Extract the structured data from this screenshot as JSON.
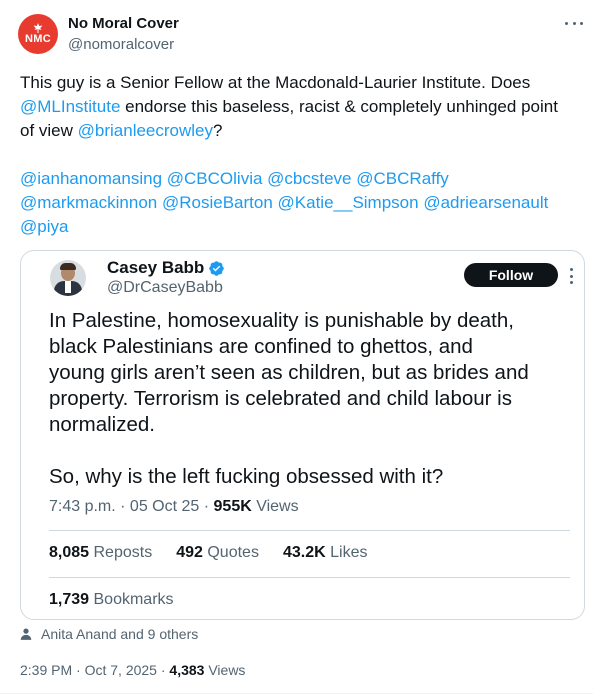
{
  "post": {
    "author": {
      "name": "No Moral Cover",
      "handle": "@nomoralcover",
      "avatar_text": "NMC",
      "avatar_color": "#e63b2e"
    },
    "text": {
      "line1": "This guy is a Senior Fellow at the Macdonald-Laurier Institute. Does",
      "mention_mli": "@MLInstitute",
      "line2_rest": " endorse this baseless, racist & completely unhinged point",
      "line3_pre": "of view ",
      "mention_crowley": "@brianleecrowley",
      "line3_post": "?",
      "mentions_line1": [
        "@ianhanomansing",
        "@CBCOlivia",
        "@cbcsteve",
        "@CBCRaffy"
      ],
      "mentions_line2": [
        "@markmackinnon",
        "@RosieBarton",
        "@Katie__Simpson",
        "@adriearsenault"
      ],
      "mentions_line3": [
        "@piya"
      ]
    },
    "quoted": {
      "name": "Casey Babb",
      "handle": "@DrCaseyBabb",
      "follow_label": "Follow",
      "lines": [
        "In Palestine, homosexuality is punishable by death,",
        "black Palestinians are confined to ghettos, and",
        "young girls aren’t seen as children, but as brides and",
        "property. Terrorism is celebrated and child labour is",
        "normalized."
      ],
      "closing_line": "So, why is the left fucking obsessed with it?",
      "time": "7:43 p.m. · 05 Oct 25 · ",
      "views_count": "955K",
      "views_label": " Views",
      "reposts_count": "8,085",
      "reposts_label": "Reposts",
      "quotes_count": "492",
      "quotes_label": "Quotes",
      "likes_count": "43.2K",
      "likes_label": "Likes",
      "bookmarks_count": "1,739",
      "bookmarks_label": "Bookmarks"
    },
    "liked_by": "Anita Anand and 9 others",
    "footer": {
      "time": "2:39 PM · Oct 7, 2025 · ",
      "views_count": "4,383",
      "views_label": " Views"
    },
    "colors": {
      "link": "#1d9bf0",
      "text": "#0f1419",
      "secondary": "#536471",
      "border": "#cfd9de",
      "verified": "#1d9bf0"
    },
    "icons": [
      "more-horizontal-icon",
      "verified-badge-icon",
      "more-vertical-icon",
      "person-icon"
    ]
  }
}
